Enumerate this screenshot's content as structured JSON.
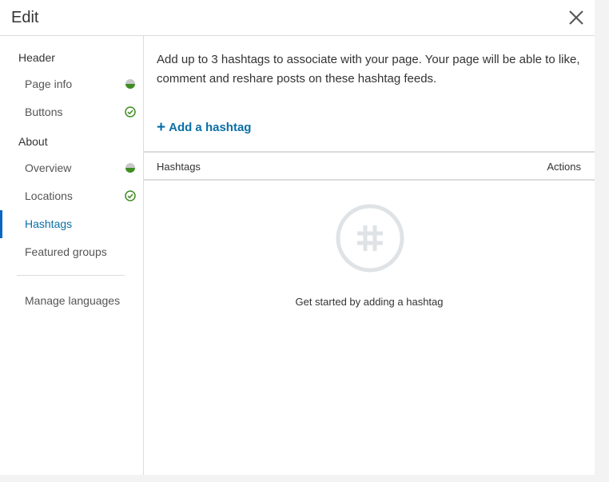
{
  "modal": {
    "title": "Edit",
    "close_icon": "close-icon"
  },
  "sidebar": {
    "sections": [
      {
        "heading": "Header",
        "items": [
          {
            "label": "Page info",
            "status": "partial"
          },
          {
            "label": "Buttons",
            "status": "complete"
          }
        ]
      },
      {
        "heading": "About",
        "items": [
          {
            "label": "Overview",
            "status": "partial"
          },
          {
            "label": "Locations",
            "status": "complete"
          },
          {
            "label": "Hashtags",
            "status": "active"
          },
          {
            "label": "Featured groups",
            "status": "none"
          }
        ]
      }
    ],
    "manage_languages": "Manage languages"
  },
  "main": {
    "intro": "Add up to 3 hashtags to associate with your page. Your page will be able to like, comment and reshare posts on these hashtag feeds.",
    "add_link": "Add a hashtag",
    "table": {
      "col_left": "Hashtags",
      "col_right": "Actions"
    },
    "empty_icon": "hashtag-icon",
    "empty_text": "Get started by adding a hashtag"
  },
  "colors": {
    "accent": "#0a66c2",
    "success": "#3f8d21",
    "border": "#dcdcdc"
  }
}
